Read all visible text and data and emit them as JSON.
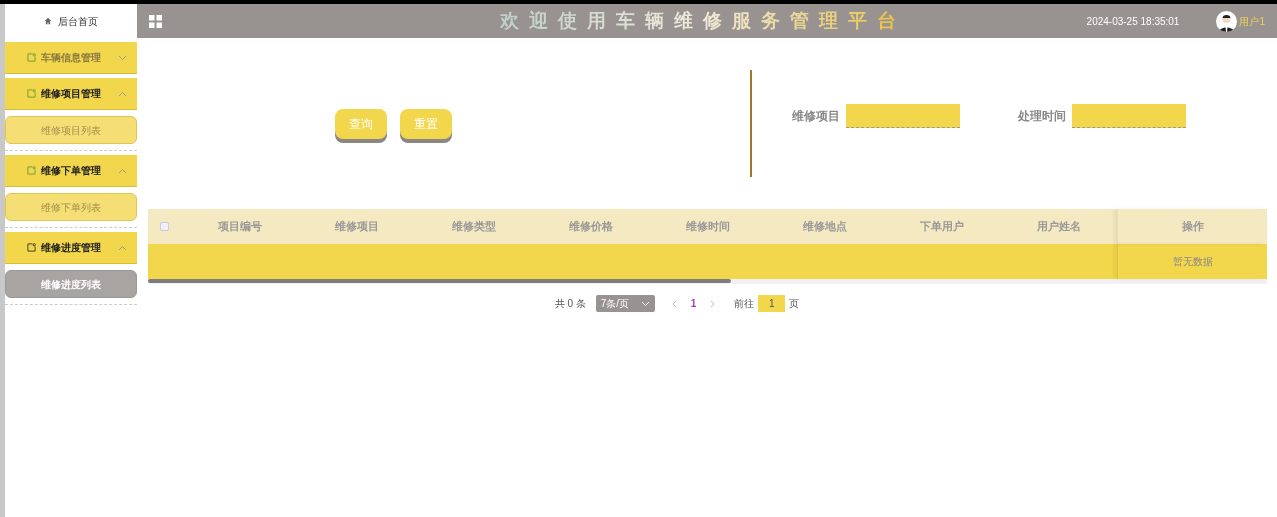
{
  "sidebar": {
    "home": "后台首页",
    "groups": [
      {
        "label": "车辆信息管理",
        "expanded": false
      },
      {
        "label": "维修项目管理",
        "expanded": true,
        "children": [
          {
            "label": "维修项目列表",
            "selected": false
          }
        ]
      },
      {
        "label": "维修下单管理",
        "expanded": true,
        "children": [
          {
            "label": "维修下单列表",
            "selected": false
          }
        ]
      },
      {
        "label": "维修进度管理",
        "expanded": true,
        "children": [
          {
            "label": "维修进度列表",
            "selected": true
          }
        ]
      }
    ]
  },
  "header": {
    "title": "欢迎使用车辆维修服务管理平台",
    "datetime": "2024-03-25 18:35:01",
    "user": "用户1"
  },
  "search": {
    "buttons": [
      "查询",
      "重置"
    ],
    "fields": [
      {
        "label": "维修项目"
      },
      {
        "label": "处理时间"
      }
    ]
  },
  "table": {
    "columns": [
      "项目编号",
      "维修项目",
      "维修类型",
      "维修价格",
      "维修时间",
      "维修地点",
      "下单用户",
      "用户姓名"
    ],
    "action_column": "操作",
    "empty_text": "暂无数据",
    "select_all_checked": false
  },
  "pagination": {
    "total": "共 0 条",
    "page_size": "7条/页",
    "pages": [
      {
        "label": "1",
        "selected": true
      }
    ],
    "goto_label": "前往",
    "goto_value": "1",
    "goto_suffix": "页"
  }
}
